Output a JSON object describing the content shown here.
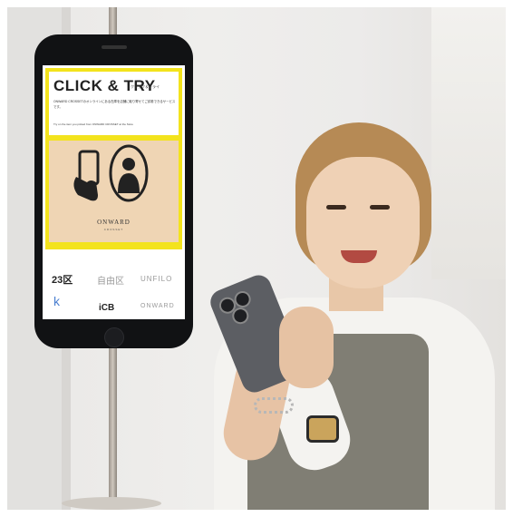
{
  "screen": {
    "title": "CLICK & TRY",
    "subtitle": "クリック＆トライ",
    "description_jp": "ONWARD CROSSETのオンラインにある在庫を店舗に取り寄せてご試着できるサービスです。",
    "description_en": "Try on the item you picked from ONWARD CROSSET at the Store",
    "logo": "ONWARD",
    "logo_sub": "CROSSET",
    "brands": [
      "23区",
      "自由区",
      "UNFILO",
      "iCB",
      "ONWARD"
    ]
  },
  "colors": {
    "accent_yellow": "#f3e31d",
    "illustration_bg": "#efd5b4",
    "phone_body": "#111214"
  }
}
